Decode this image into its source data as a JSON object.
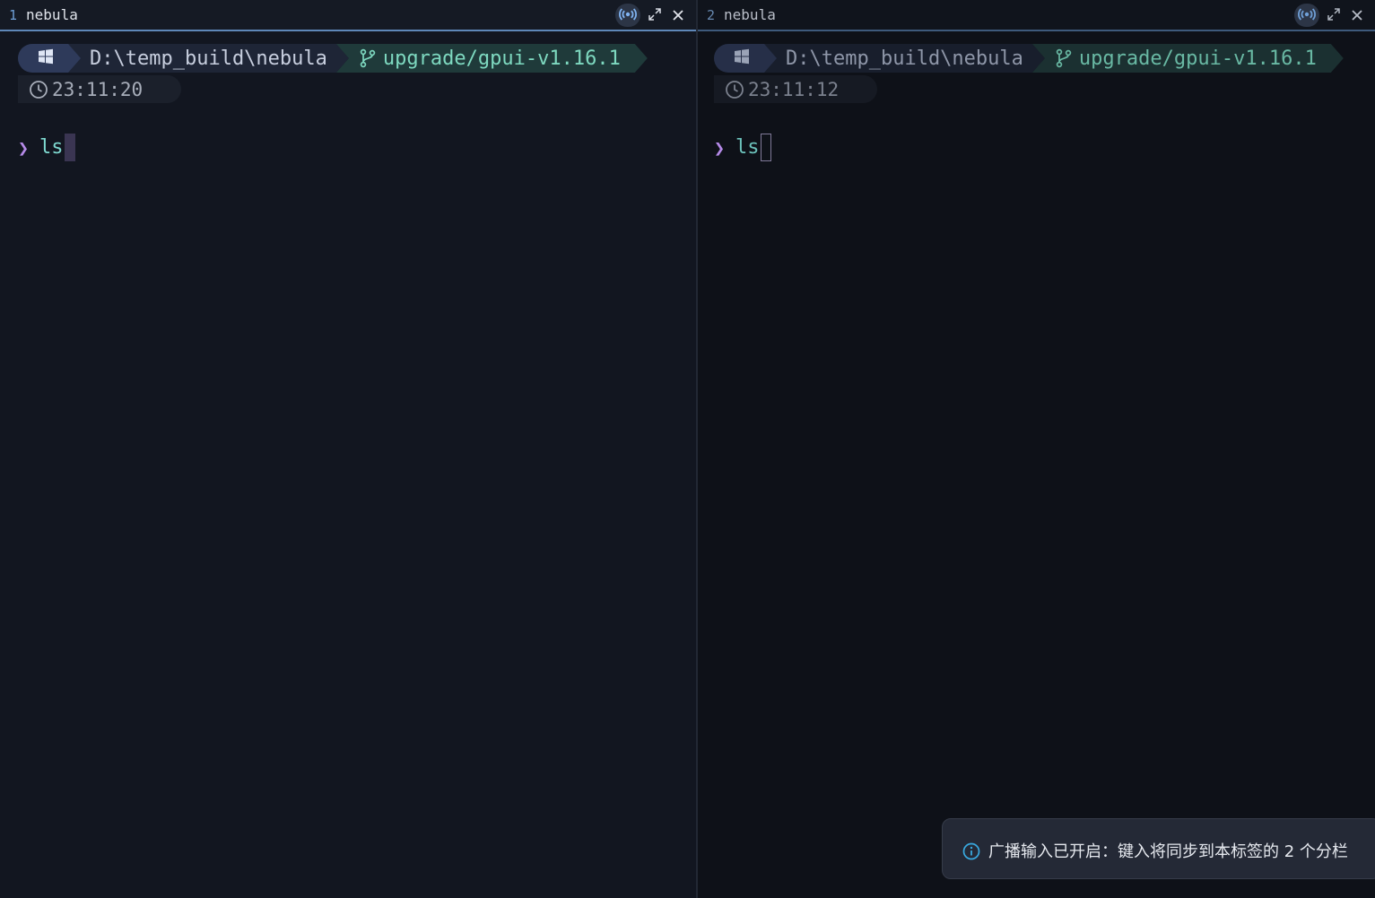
{
  "panes": [
    {
      "index": "1",
      "title": "nebula",
      "path": "D:\\temp_build\\nebula",
      "branch": "upgrade/gpui-v1.16.1",
      "time": "23:11:20",
      "prompt": "❯",
      "command": "ls"
    },
    {
      "index": "2",
      "title": "nebula",
      "path": "D:\\temp_build\\nebula",
      "branch": "upgrade/gpui-v1.16.1",
      "time": "23:11:12",
      "prompt": "❯",
      "command": "ls"
    }
  ],
  "toast": {
    "message": "广播输入已开启：键入将同步到本标签的 2 个分栏"
  },
  "icons": {
    "broadcast": "broadcast-icon",
    "maximize": "expand-icon",
    "close": "close-icon",
    "os": "windows-icon",
    "git": "git-branch-icon",
    "clock": "clock-icon",
    "info": "info-icon"
  },
  "colors": {
    "accent": "#5e87b8",
    "prompt": "#b58ae8",
    "command": "#7ed9d0",
    "branch": "#7ed9c0",
    "info": "#39a9e0"
  }
}
